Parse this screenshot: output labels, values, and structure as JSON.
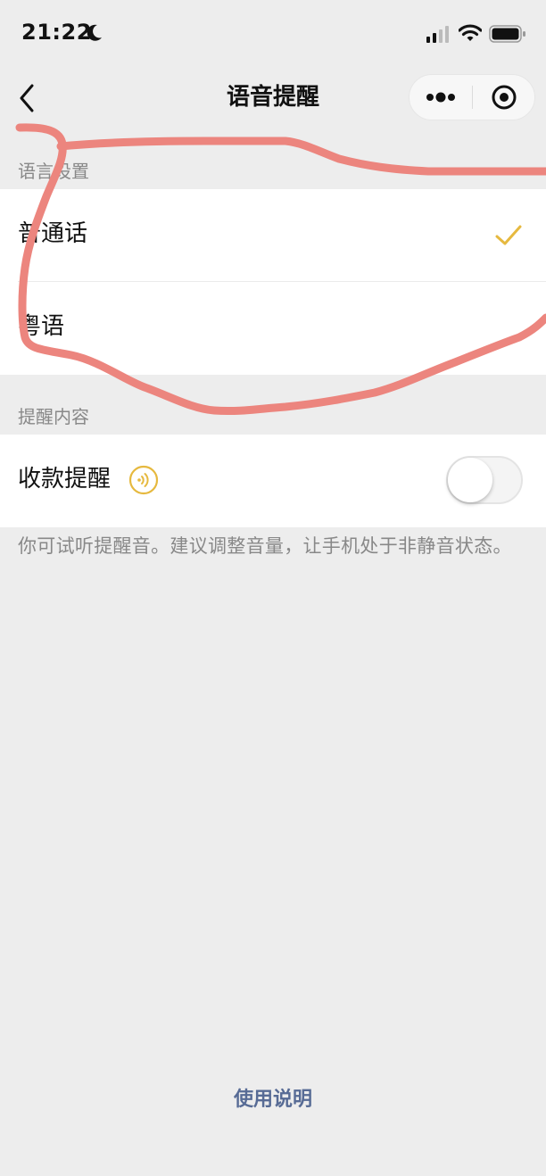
{
  "status_bar": {
    "time": "21:22"
  },
  "nav": {
    "title": "语音提醒",
    "back_icon": "chevron-left-icon",
    "more_icon": "more-dots-icon",
    "close_icon": "target-icon"
  },
  "language_section": {
    "header": "语言设置",
    "options": [
      {
        "label": "普通话",
        "selected": true
      },
      {
        "label": "粤语",
        "selected": false
      }
    ]
  },
  "content_section": {
    "header": "提醒内容",
    "payment_reminder": {
      "label": "收款提醒",
      "icon": "speaker-icon",
      "enabled": false
    }
  },
  "hint_text": "你可试听提醒音。建议调整音量，让手机处于非静音状态。",
  "help_link": "使用说明",
  "colors": {
    "accent_check": "#e6b93f",
    "link": "#576b95",
    "annotation_stroke": "#ec857e",
    "background": "#ededed"
  }
}
